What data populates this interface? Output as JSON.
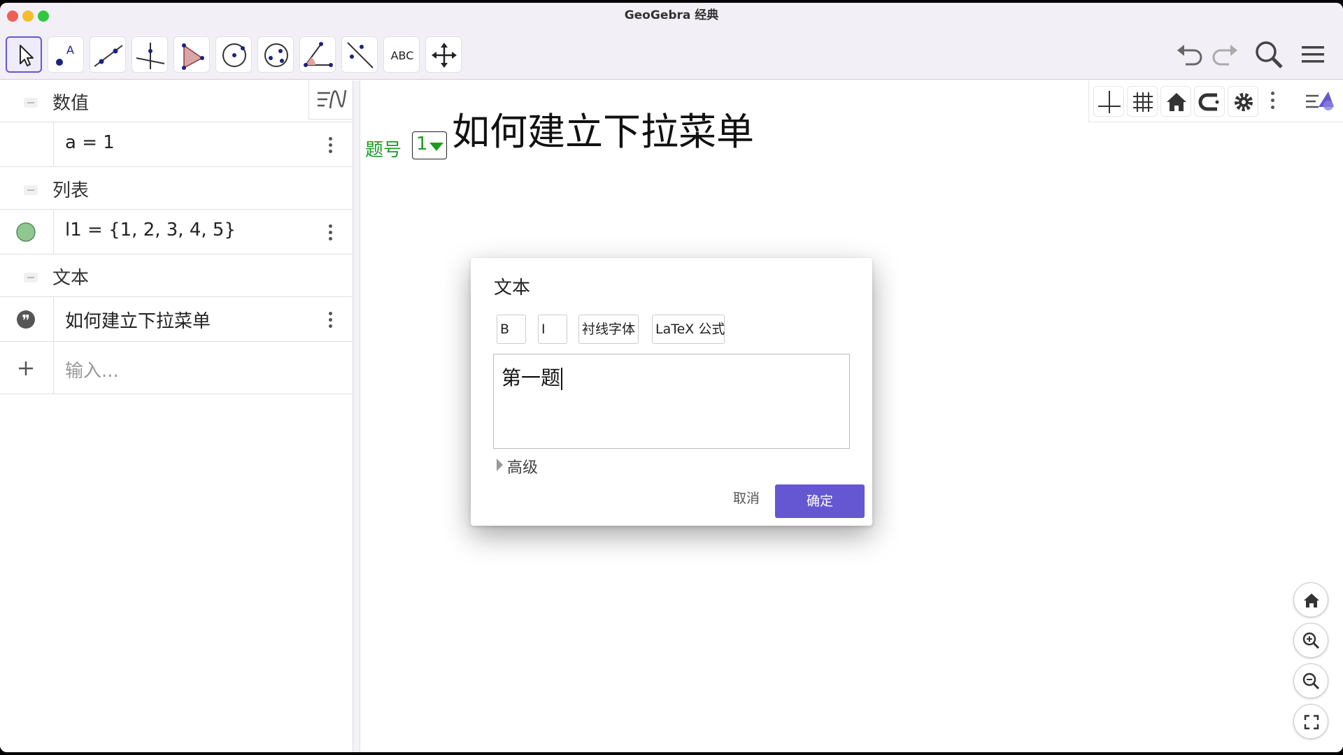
{
  "window": {
    "title": "GeoGebra 经典",
    "traffic_lights": {
      "close": "#ed5f57",
      "minimize": "#f5bd2e",
      "maximize": "#2fc840"
    }
  },
  "toolbar": {
    "tools": [
      {
        "icon": "move-arrow-icon",
        "selected": true
      },
      {
        "icon": "point-icon"
      },
      {
        "icon": "line-icon"
      },
      {
        "icon": "perpendicular-line-icon"
      },
      {
        "icon": "polygon-icon"
      },
      {
        "icon": "circle-icon"
      },
      {
        "icon": "ellipse-icon"
      },
      {
        "icon": "angle-icon"
      },
      {
        "icon": "reflect-icon"
      },
      {
        "icon": "text-tool-icon",
        "label": "ABC"
      },
      {
        "icon": "move-graphics-icon"
      }
    ],
    "right": [
      "undo-icon",
      "redo-icon",
      "search-icon",
      "menu-icon"
    ]
  },
  "algebra": {
    "sections": [
      {
        "header": "数值",
        "item": "a = 1",
        "marker": "none"
      },
      {
        "header": "列表",
        "item": "l1 = {1, 2, 3, 4, 5}",
        "marker": "green-dot"
      },
      {
        "header": "文本",
        "item": "如何建立下拉菜单",
        "marker": "quote-icon"
      }
    ],
    "input_placeholder": "输入..."
  },
  "graphics": {
    "title_text": "如何建立下拉菜单",
    "label": "题号",
    "dropdown_value": "1",
    "label_color": "#1e9b1e"
  },
  "dialog": {
    "title": "文本",
    "buttons": {
      "bold": "B",
      "italic": "I",
      "serif": "衬线字体",
      "latex": "LaTeX 公式"
    },
    "editor_text": "第一题",
    "advanced": "高级",
    "cancel": "取消",
    "ok": "确定",
    "accent": "#6557d2"
  }
}
